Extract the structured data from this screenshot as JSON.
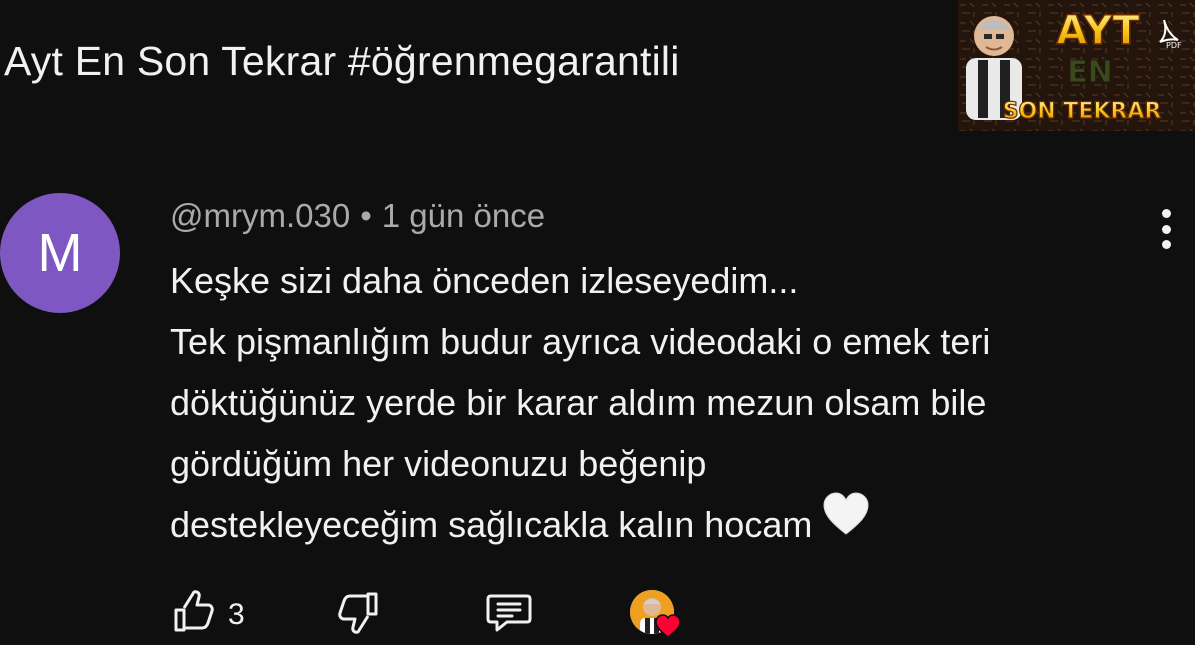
{
  "video": {
    "title": "Ayt En Son Tekrar #öğrenmegarantili",
    "thumbnail": {
      "line1": "AYT",
      "line2": "EN",
      "line3": "SON TEKRAR"
    }
  },
  "comment": {
    "avatar_letter": "M",
    "author": "@mrym.030",
    "separator": "•",
    "time": "1 gün önce",
    "lines": [
      "Keşke sizi daha önceden izleseyedim...",
      "Tek pişmanlığım budur ayrıca videodaki o emek teri",
      "döktüğünüz yerde bir karar aldım mezun olsam bile",
      "gördüğüm her videonuzu beğenip",
      "destekleyeceğim sağlıcakla kalın hocam"
    ]
  },
  "actions": {
    "like_count": "3"
  },
  "icons": {
    "menu": "more-vertical-icon",
    "like": "thumbs-up-icon",
    "dislike": "thumbs-down-icon",
    "reply": "reply-icon",
    "creator_heart": "creator-heart-icon",
    "pdf": "pdf-icon",
    "emoji": "white-heart-icon"
  },
  "colors": {
    "background": "#0f0f0f",
    "text": "#f1f1f1",
    "secondary_text": "#aaaaaa",
    "avatar": "#7e57c2",
    "heart_red": "#ff0033",
    "thumb_yellow": "#f5c518"
  }
}
